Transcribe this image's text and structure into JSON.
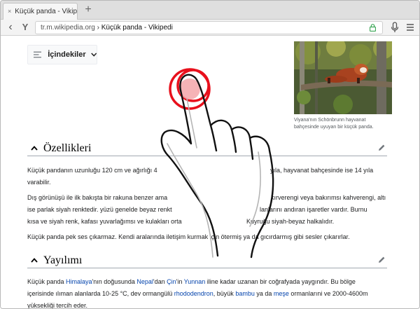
{
  "browser": {
    "tab": {
      "close_glyph": "×",
      "title": "Küçük panda - Vikipedi"
    },
    "new_tab_glyph": "+",
    "url": {
      "domain": "tr.m.wikipedia.org",
      "separator": " › ",
      "page_title": "Küçük panda - Vikipedi"
    },
    "icons": [
      "back-arrow-icon",
      "yandex-logo-icon",
      "lock-icon",
      "microphone-icon",
      "hamburger-menu-icon"
    ],
    "brand_glyph": "Y",
    "back_glyph": "‹"
  },
  "toc": {
    "label": "İçindekiler"
  },
  "infobox": {
    "caption_line1": "Viyana'nın Schönbrunn hayvanat",
    "caption_line2": "bahçesinde uyuyan bir küçük panda."
  },
  "sections": [
    {
      "title": "Özellikleri"
    },
    {
      "title": "Yayılımı"
    }
  ],
  "paragraphs": {
    "p1_line1": "Küçük pandanın uzunluğu 120 cm ve ağırlığı 4",
    "p1_line1_end": "yıla, hayvanat bahçesinde ise 14 yıla",
    "p1_line2": "varabilir.",
    "p2_line1": "Dış görünüşü ile ilk bakışta bir rakuna benzer ama",
    "p2_line1_end": "kırverengi veya bakırımsı kahverengi, altı",
    "p2_line2_start": "ise parlak siyah renktedir. yüzü genelde beyaz renkt",
    "p2_line2_end": "lanlarını andıran işaretler vardır. Burnu",
    "p2_line3_start": "kısa ve siyah renk, kafası yuvarlağımsı ve kulakları orta",
    "p2_line3_end": "Kuyruğu siyah-beyaz halkalıdır.",
    "p3": "Küçük panda pek ses çıkarmaz. Kendi aralarında iletişim kurmak için ötermiş ya da gıcırdarmış gibi sesler çıkarırlar.",
    "p4_a": "Küçük panda ",
    "p4_link1": "Himalaya",
    "p4_b": "'nın doğusunda ",
    "p4_link2": "Nepal",
    "p4_c": "'dan ",
    "p4_link3": "Çin",
    "p4_d": "'in ",
    "p4_link4": "Yunnan",
    "p4_e": " iline kadar uzanan bir coğrafyada yaygındır. Bu bölge",
    "p4_line2_a": "içerisinde ılıman alanlarda 10-25 °C, dev ormangülü ",
    "p4_link5": "rhododendron",
    "p4_line2_b": ", büyük ",
    "p4_link6": "bambu",
    "p4_line2_c": " ya da ",
    "p4_link7": "meşe",
    "p4_line2_d": " ormanlarıni ve 2000-4600m",
    "p4_line3": "yüksekliği tercih eder."
  },
  "colors": {
    "link": "#0645ad",
    "tap_ring": "#e8101c",
    "tap_fill": "#f4a6a9"
  },
  "gesture": {
    "type": "tap",
    "icon": "hand-tap-icon"
  }
}
